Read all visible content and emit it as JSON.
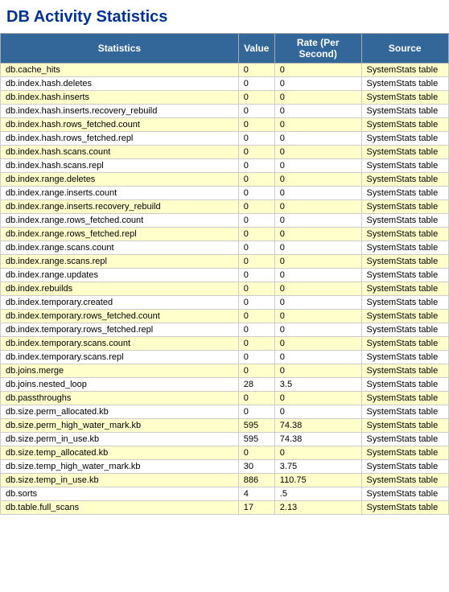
{
  "title": "DB Activity Statistics",
  "table": {
    "columns": [
      "Statistics",
      "Value",
      "Rate (Per Second)",
      "Source"
    ],
    "rows": [
      {
        "stat": "db.cache_hits",
        "value": "0",
        "rate": "0",
        "source": "SystemStats table"
      },
      {
        "stat": "db.index.hash.deletes",
        "value": "0",
        "rate": "0",
        "source": "SystemStats table"
      },
      {
        "stat": "db.index.hash.inserts",
        "value": "0",
        "rate": "0",
        "source": "SystemStats table"
      },
      {
        "stat": "db.index.hash.inserts.recovery_rebuild",
        "value": "0",
        "rate": "0",
        "source": "SystemStats table"
      },
      {
        "stat": "db.index.hash.rows_fetched.count",
        "value": "0",
        "rate": "0",
        "source": "SystemStats table"
      },
      {
        "stat": "db.index.hash.rows_fetched.repl",
        "value": "0",
        "rate": "0",
        "source": "SystemStats table"
      },
      {
        "stat": "db.index.hash.scans.count",
        "value": "0",
        "rate": "0",
        "source": "SystemStats table"
      },
      {
        "stat": "db.index.hash.scans.repl",
        "value": "0",
        "rate": "0",
        "source": "SystemStats table"
      },
      {
        "stat": "db.index.range.deletes",
        "value": "0",
        "rate": "0",
        "source": "SystemStats table"
      },
      {
        "stat": "db.index.range.inserts.count",
        "value": "0",
        "rate": "0",
        "source": "SystemStats table"
      },
      {
        "stat": "db.index.range.inserts.recovery_rebuild",
        "value": "0",
        "rate": "0",
        "source": "SystemStats table"
      },
      {
        "stat": "db.index.range.rows_fetched.count",
        "value": "0",
        "rate": "0",
        "source": "SystemStats table"
      },
      {
        "stat": "db.index.range.rows_fetched.repl",
        "value": "0",
        "rate": "0",
        "source": "SystemStats table"
      },
      {
        "stat": "db.index.range.scans.count",
        "value": "0",
        "rate": "0",
        "source": "SystemStats table"
      },
      {
        "stat": "db.index.range.scans.repl",
        "value": "0",
        "rate": "0",
        "source": "SystemStats table"
      },
      {
        "stat": "db.index.range.updates",
        "value": "0",
        "rate": "0",
        "source": "SystemStats table"
      },
      {
        "stat": "db.index.rebuilds",
        "value": "0",
        "rate": "0",
        "source": "SystemStats table"
      },
      {
        "stat": "db.index.temporary.created",
        "value": "0",
        "rate": "0",
        "source": "SystemStats table"
      },
      {
        "stat": "db.index.temporary.rows_fetched.count",
        "value": "0",
        "rate": "0",
        "source": "SystemStats table"
      },
      {
        "stat": "db.index.temporary.rows_fetched.repl",
        "value": "0",
        "rate": "0",
        "source": "SystemStats table"
      },
      {
        "stat": "db.index.temporary.scans.count",
        "value": "0",
        "rate": "0",
        "source": "SystemStats table"
      },
      {
        "stat": "db.index.temporary.scans.repl",
        "value": "0",
        "rate": "0",
        "source": "SystemStats table"
      },
      {
        "stat": "db.joins.merge",
        "value": "0",
        "rate": "0",
        "source": "SystemStats table"
      },
      {
        "stat": "db.joins.nested_loop",
        "value": "28",
        "rate": "3.5",
        "source": "SystemStats table"
      },
      {
        "stat": "db.passthroughs",
        "value": "0",
        "rate": "0",
        "source": "SystemStats table"
      },
      {
        "stat": "db.size.perm_allocated.kb",
        "value": "0",
        "rate": "0",
        "source": "SystemStats table"
      },
      {
        "stat": "db.size.perm_high_water_mark.kb",
        "value": "595",
        "rate": "74.38",
        "source": "SystemStats table"
      },
      {
        "stat": "db.size.perm_in_use.kb",
        "value": "595",
        "rate": "74.38",
        "source": "SystemStats table"
      },
      {
        "stat": "db.size.temp_allocated.kb",
        "value": "0",
        "rate": "0",
        "source": "SystemStats table"
      },
      {
        "stat": "db.size.temp_high_water_mark.kb",
        "value": "30",
        "rate": "3.75",
        "source": "SystemStats table"
      },
      {
        "stat": "db.size.temp_in_use.kb",
        "value": "886",
        "rate": "110.75",
        "source": "SystemStats table"
      },
      {
        "stat": "db.sorts",
        "value": "4",
        "rate": ".5",
        "source": "SystemStats table"
      },
      {
        "stat": "db.table.full_scans",
        "value": "17",
        "rate": "2.13",
        "source": "SystemStats table"
      }
    ]
  }
}
